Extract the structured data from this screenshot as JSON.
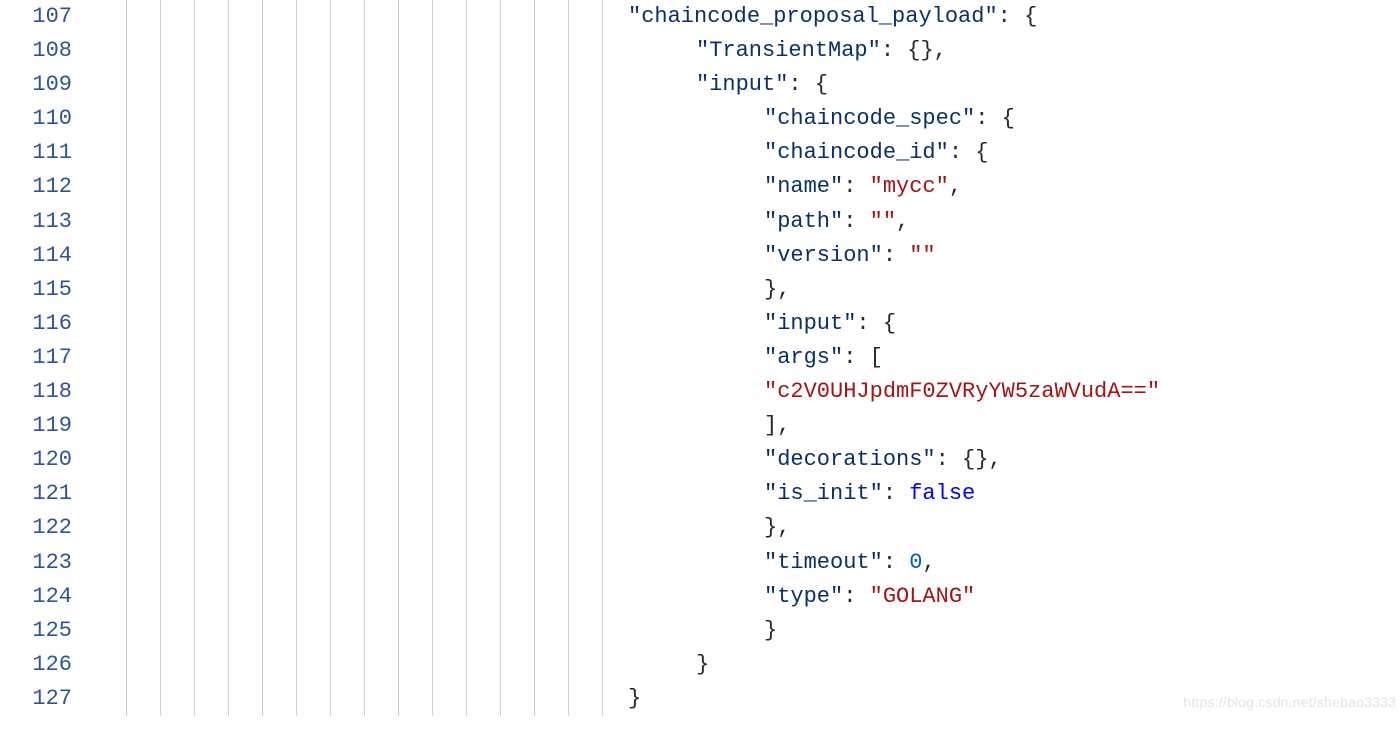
{
  "line_numbers": [
    107,
    108,
    109,
    110,
    111,
    112,
    113,
    114,
    115,
    116,
    117,
    118,
    119,
    120,
    121,
    122,
    123,
    124,
    125,
    126,
    127
  ],
  "indent_guides": [
    38,
    72,
    106,
    140,
    174,
    208,
    242,
    276,
    310,
    344,
    378,
    412,
    446,
    480,
    514
  ],
  "lines": [
    {
      "indent": 540,
      "tokens": [
        {
          "cls": "tok-key",
          "t": "\"chaincode_proposal_payload\""
        },
        {
          "cls": "tok-punct",
          "t": ": {"
        }
      ]
    },
    {
      "indent": 608,
      "tokens": [
        {
          "cls": "tok-key",
          "t": "\"TransientMap\""
        },
        {
          "cls": "tok-punct",
          "t": ": {},"
        }
      ]
    },
    {
      "indent": 608,
      "tokens": [
        {
          "cls": "tok-key",
          "t": "\"input\""
        },
        {
          "cls": "tok-punct",
          "t": ": {"
        }
      ]
    },
    {
      "indent": 676,
      "tokens": [
        {
          "cls": "tok-key",
          "t": "\"chaincode_spec\""
        },
        {
          "cls": "tok-punct",
          "t": ": {"
        }
      ]
    },
    {
      "indent": 676,
      "tokens": [
        {
          "cls": "tok-key",
          "t": "\"chaincode_id\""
        },
        {
          "cls": "tok-punct",
          "t": ": {"
        }
      ]
    },
    {
      "indent": 676,
      "tokens": [
        {
          "cls": "tok-key",
          "t": "\"name\""
        },
        {
          "cls": "tok-punct",
          "t": ": "
        },
        {
          "cls": "tok-str",
          "t": "\"mycc\""
        },
        {
          "cls": "tok-punct",
          "t": ","
        }
      ]
    },
    {
      "indent": 676,
      "tokens": [
        {
          "cls": "tok-key",
          "t": "\"path\""
        },
        {
          "cls": "tok-punct",
          "t": ": "
        },
        {
          "cls": "tok-str",
          "t": "\"\""
        },
        {
          "cls": "tok-punct",
          "t": ","
        }
      ]
    },
    {
      "indent": 676,
      "tokens": [
        {
          "cls": "tok-key",
          "t": "\"version\""
        },
        {
          "cls": "tok-punct",
          "t": ": "
        },
        {
          "cls": "tok-str",
          "t": "\"\""
        }
      ]
    },
    {
      "indent": 676,
      "tokens": [
        {
          "cls": "tok-punct",
          "t": "},"
        }
      ]
    },
    {
      "indent": 676,
      "tokens": [
        {
          "cls": "tok-key",
          "t": "\"input\""
        },
        {
          "cls": "tok-punct",
          "t": ": {"
        }
      ]
    },
    {
      "indent": 676,
      "tokens": [
        {
          "cls": "tok-key",
          "t": "\"args\""
        },
        {
          "cls": "tok-punct",
          "t": ": ["
        }
      ]
    },
    {
      "indent": 676,
      "tokens": [
        {
          "cls": "tok-str",
          "t": "\"c2V0UHJpdmF0ZVRyYW5zaWVudA==\""
        }
      ]
    },
    {
      "indent": 676,
      "tokens": [
        {
          "cls": "tok-punct",
          "t": "],"
        }
      ]
    },
    {
      "indent": 676,
      "tokens": [
        {
          "cls": "tok-key",
          "t": "\"decorations\""
        },
        {
          "cls": "tok-punct",
          "t": ": {},"
        }
      ]
    },
    {
      "indent": 676,
      "tokens": [
        {
          "cls": "tok-key",
          "t": "\"is_init\""
        },
        {
          "cls": "tok-punct",
          "t": ": "
        },
        {
          "cls": "tok-kw",
          "t": "false"
        }
      ]
    },
    {
      "indent": 676,
      "tokens": [
        {
          "cls": "tok-punct",
          "t": "},"
        }
      ]
    },
    {
      "indent": 676,
      "tokens": [
        {
          "cls": "tok-key",
          "t": "\"timeout\""
        },
        {
          "cls": "tok-punct",
          "t": ": "
        },
        {
          "cls": "tok-num",
          "t": "0"
        },
        {
          "cls": "tok-punct",
          "t": ","
        }
      ]
    },
    {
      "indent": 676,
      "tokens": [
        {
          "cls": "tok-key",
          "t": "\"type\""
        },
        {
          "cls": "tok-punct",
          "t": ": "
        },
        {
          "cls": "tok-str",
          "t": "\"GOLANG\""
        }
      ]
    },
    {
      "indent": 676,
      "tokens": [
        {
          "cls": "tok-punct",
          "t": "}"
        }
      ]
    },
    {
      "indent": 608,
      "tokens": [
        {
          "cls": "tok-punct",
          "t": "}"
        }
      ]
    },
    {
      "indent": 540,
      "tokens": [
        {
          "cls": "tok-punct",
          "t": "}"
        }
      ]
    }
  ],
  "watermark": "https://blog.csdn.net/shebao3333"
}
